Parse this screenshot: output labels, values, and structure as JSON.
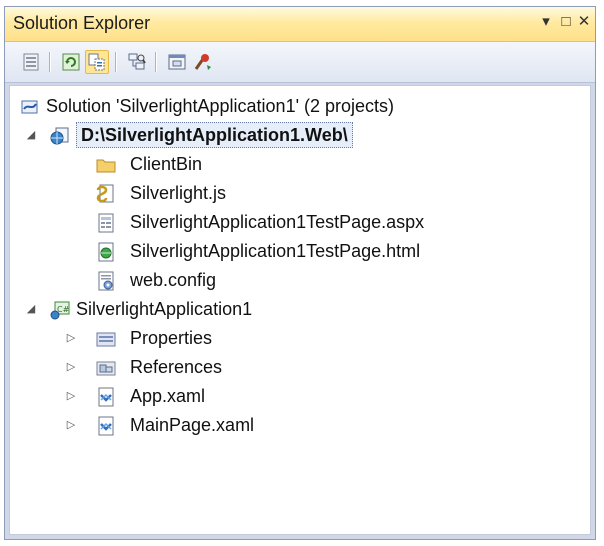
{
  "window": {
    "title": "Solution Explorer",
    "pin_glyph": "▾",
    "maximize_glyph": "□",
    "close_glyph": "✕"
  },
  "toolbar": {
    "buttons": [
      {
        "name": "properties-icon"
      },
      {
        "name": "refresh-icon"
      },
      {
        "name": "show-all-files-icon",
        "active": true
      },
      {
        "name": "view-class-diagram-icon"
      },
      {
        "name": "view-designer-icon"
      },
      {
        "name": "configure-icon"
      }
    ]
  },
  "tree": {
    "solution": {
      "label": "Solution 'SilverlightApplication1' (2 projects)",
      "icon": "solution-icon"
    },
    "web_project": {
      "label": "D:\\SilverlightApplication1.Web\\",
      "icon": "web-project-icon",
      "expanded": true,
      "selected": true,
      "children": [
        {
          "label": "ClientBin",
          "icon": "folder-icon"
        },
        {
          "label": "Silverlight.js",
          "icon": "js-file-icon"
        },
        {
          "label": "SilverlightApplication1TestPage.aspx",
          "icon": "aspx-file-icon"
        },
        {
          "label": "SilverlightApplication1TestPage.html",
          "icon": "html-file-icon"
        },
        {
          "label": "web.config",
          "icon": "config-file-icon"
        }
      ]
    },
    "app_project": {
      "label": "SilverlightApplication1",
      "icon": "csharp-project-icon",
      "expanded": true,
      "children": [
        {
          "label": "Properties",
          "icon": "properties-folder-icon"
        },
        {
          "label": "References",
          "icon": "references-folder-icon"
        },
        {
          "label": "App.xaml",
          "icon": "xaml-file-icon"
        },
        {
          "label": "MainPage.xaml",
          "icon": "xaml-file-icon"
        }
      ]
    },
    "expanded_glyph": "◢",
    "collapsed_glyph": "▷"
  },
  "colors": {
    "titlebar": "#ffe8a0",
    "selection": "#e6eef9",
    "frame": "#d0d8e8"
  }
}
